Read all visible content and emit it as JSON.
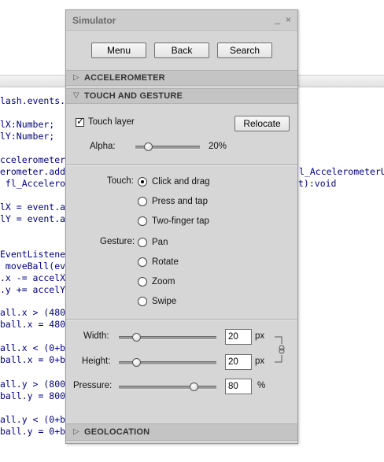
{
  "code_lines": [
    "lash.events.",
    "lX:Number;",
    "lY:Number;",
    "ccelerometer",
    "erometer.add",
    " fl_Accelero",
    "lX = event.a",
    "lY = event.a",
    "EventListene",
    " moveBall(ev",
    ".x -= accelX",
    ".y += accelY",
    "all.x > (480",
    "ball.x = 480",
    "all.x < (0+b",
    "ball.x = 0+b",
    "all.y > (800",
    "ball.y = 800-",
    "all.y < (0+b",
    "ball.y = 0+b"
  ],
  "code_right": {
    "line1": "l_AccelerometerU",
    "line2": "t):void"
  },
  "simulator": {
    "title": "Simulator",
    "minimize_glyph": "_",
    "close_glyph": "×",
    "buttons": {
      "menu": "Menu",
      "back": "Back",
      "search": "Search"
    },
    "sections": {
      "accelerometer": "ACCELEROMETER",
      "touch": "TOUCH AND GESTURE",
      "geolocation": "GEOLOCATION"
    },
    "touch_layer": {
      "label": "Touch layer",
      "checked": true
    },
    "relocate": "Relocate",
    "alpha": {
      "label": "Alpha:",
      "value_text": "20%",
      "value": 0.2
    },
    "touch_label": "Touch:",
    "touch_options": [
      "Click and drag",
      "Press and tap",
      "Two-finger tap"
    ],
    "touch_selected": 0,
    "gesture_label": "Gesture:",
    "gesture_options": [
      "Pan",
      "Rotate",
      "Zoom",
      "Swipe"
    ],
    "width": {
      "label": "Width:",
      "value": "20",
      "unit": "px",
      "fraction": 0.18
    },
    "height": {
      "label": "Height:",
      "value": "20",
      "unit": "px",
      "fraction": 0.18
    },
    "pressure": {
      "label": "Pressure:",
      "value": "80",
      "unit": "%",
      "fraction": 0.77
    }
  }
}
